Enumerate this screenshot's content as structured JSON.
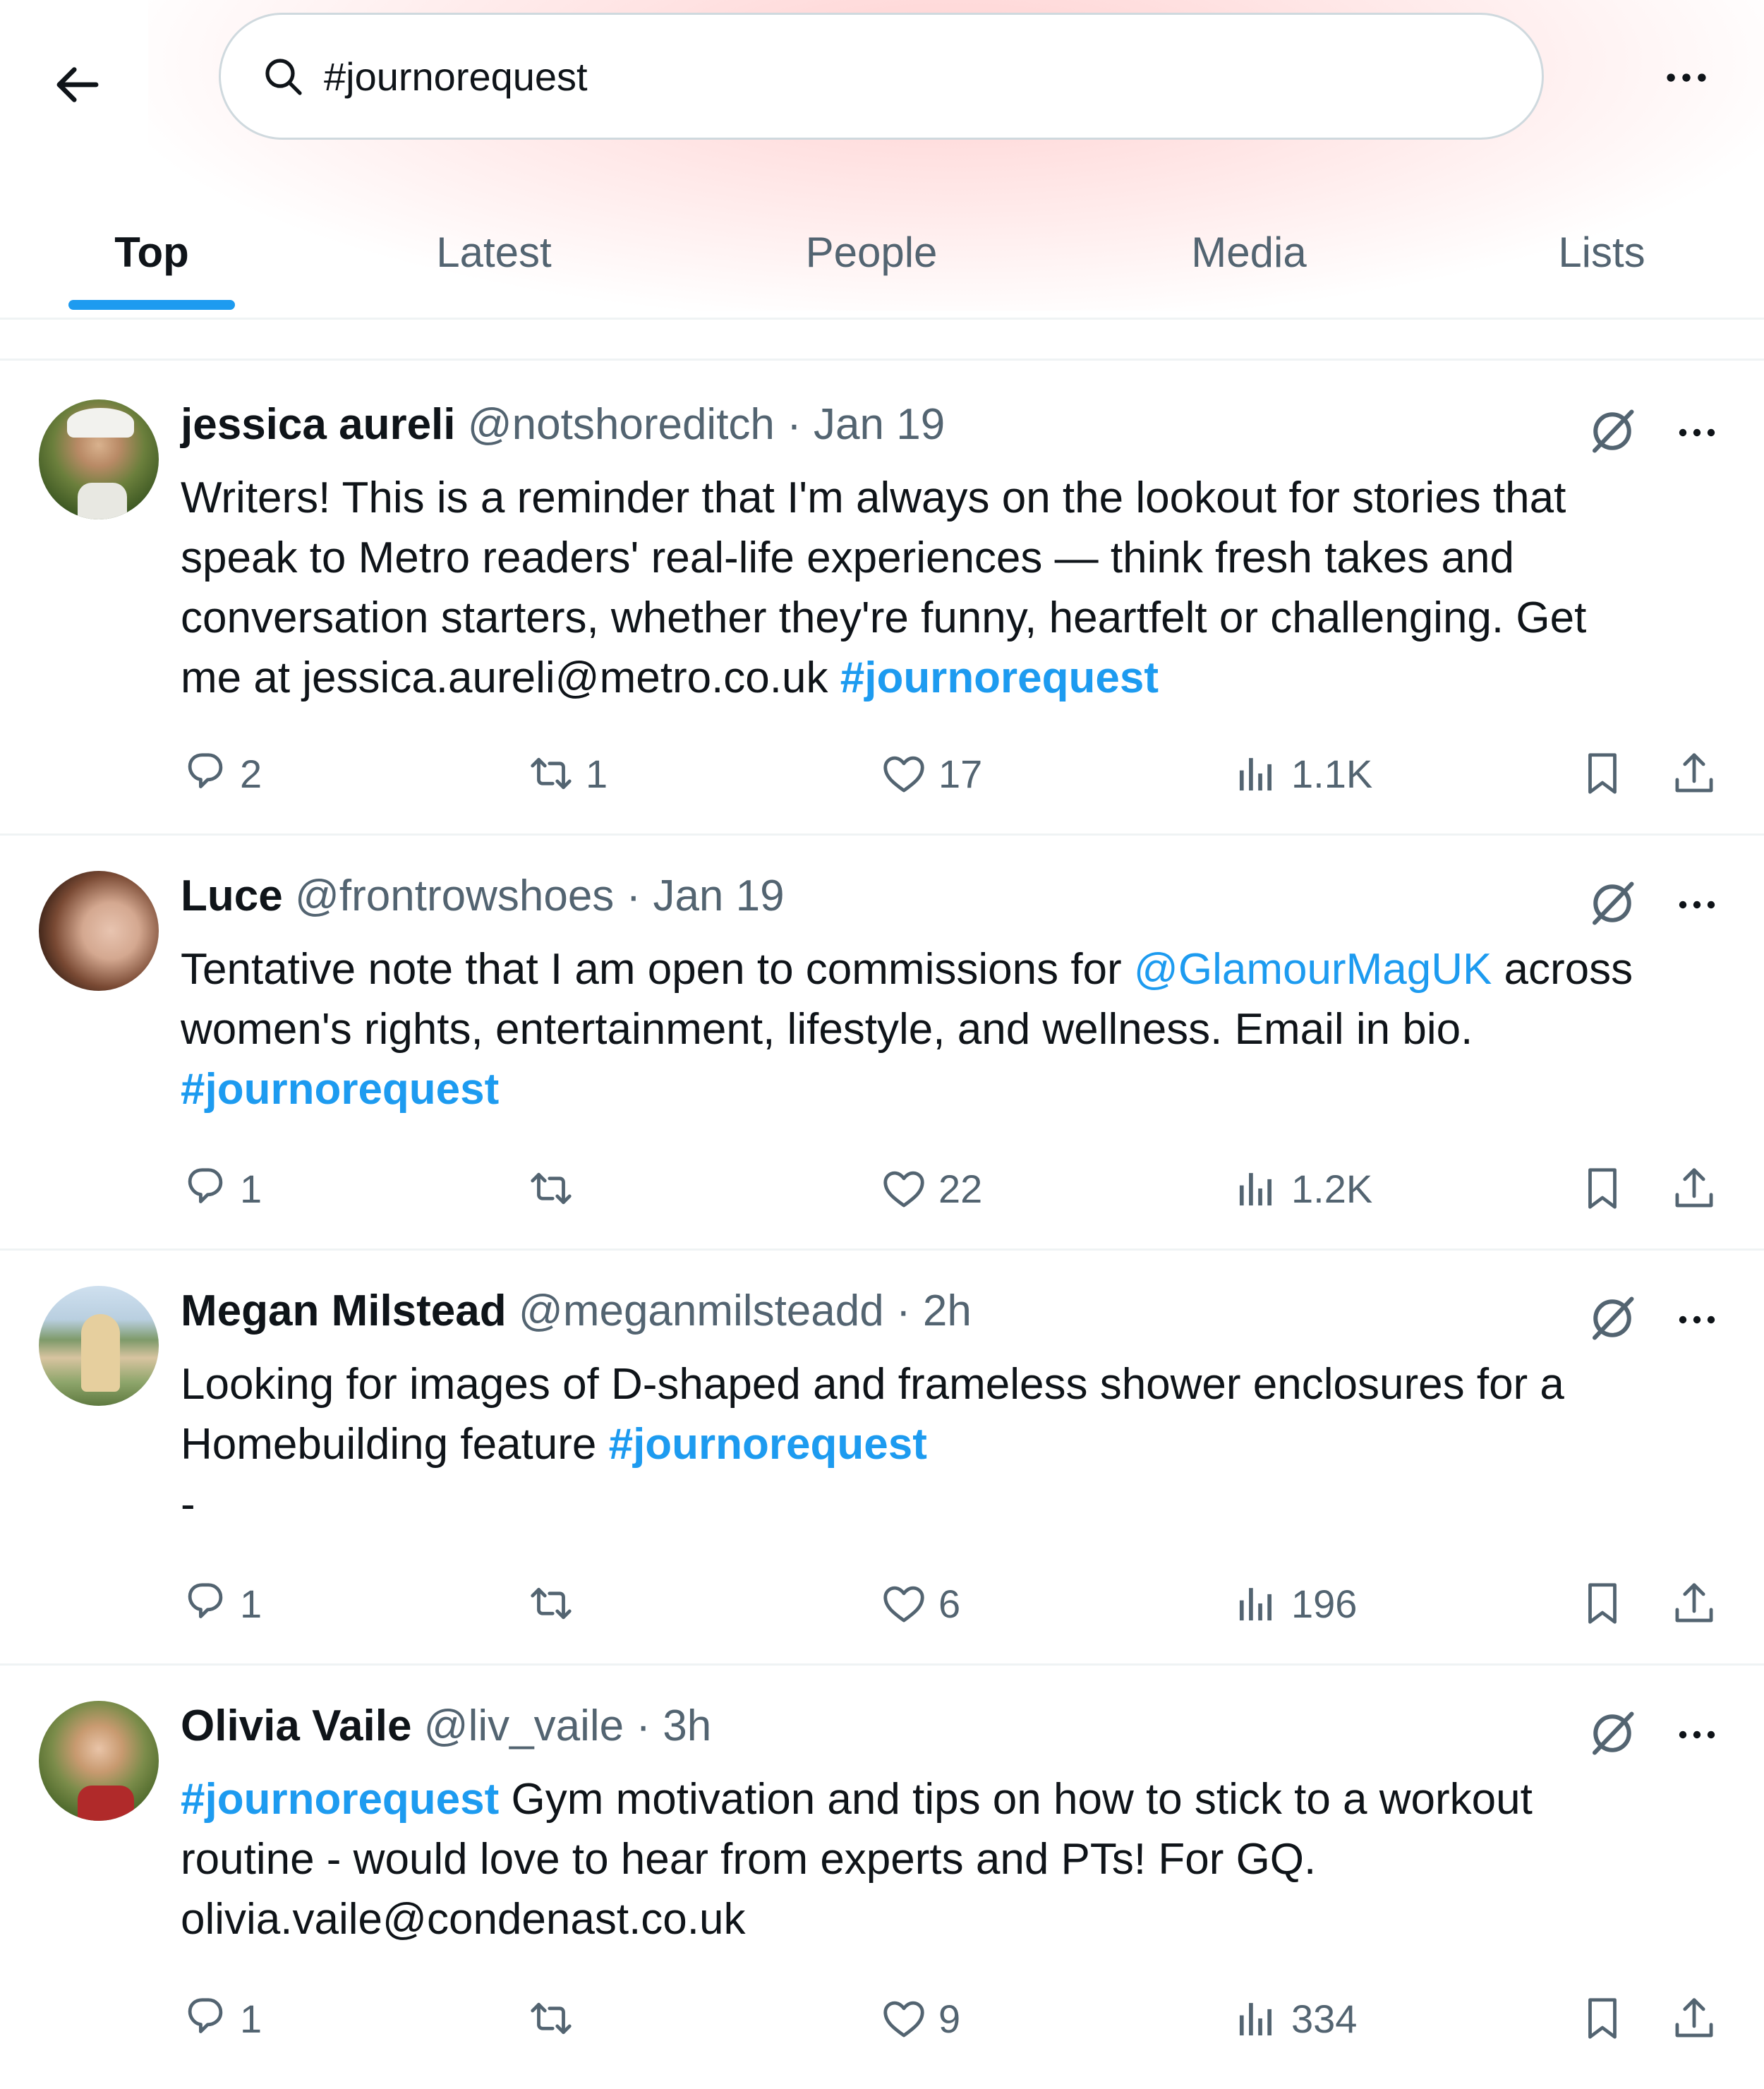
{
  "search": {
    "query": "#journorequest"
  },
  "tabs": [
    {
      "label": "Top"
    },
    {
      "label": "Latest"
    },
    {
      "label": "People"
    },
    {
      "label": "Media"
    },
    {
      "label": "Lists"
    }
  ],
  "tweets": [
    {
      "name": "jessica aureli",
      "handle": "@notshoreditch",
      "sep": "·",
      "time": "Jan 19",
      "text": {
        "l1": "Writers! This is a reminder that I'm always on the lookout for stories that",
        "l2": "speak to Metro readers' real-life experiences — think fresh takes and",
        "l3": "conversation starters, whether they're funny, heartfelt or challenging. Get",
        "l4a": "me at jessica.aureli@metro.co.uk ",
        "l4b": "#journorequest"
      },
      "replies": "2",
      "reposts": "1",
      "likes": "17",
      "views": "1.1K"
    },
    {
      "name": "Luce",
      "handle": "@frontrowshoes",
      "sep": "·",
      "time": "Jan 19",
      "text": {
        "l1a": "Tentative note that I am open to commissions for ",
        "l1b": "@GlamourMagUK",
        "l1c": " across",
        "l2": "women's rights, entertainment, lifestyle, and wellness. Email in bio.",
        "l3": "#journorequest"
      },
      "replies": "1",
      "reposts": "",
      "likes": "22",
      "views": "1.2K"
    },
    {
      "name": "Megan Milstead",
      "handle": "@meganmilsteadd",
      "sep": "·",
      "time": "2h",
      "text": {
        "l1": "Looking for images of D-shaped and frameless shower enclosures for a",
        "l2a": "Homebuilding feature ",
        "l2b": "#journorequest",
        "l3": "-"
      },
      "replies": "1",
      "reposts": "",
      "likes": "6",
      "views": "196"
    },
    {
      "name": "Olivia Vaile",
      "handle": "@liv_vaile",
      "sep": "·",
      "time": "3h",
      "text": {
        "l1a": "#journorequest",
        "l1b": " Gym motivation and tips on how to stick to a workout",
        "l2": "routine - would love to hear from experts and PTs! For GQ.",
        "l3": "olivia.vaile@condenast.co.uk"
      },
      "replies": "1",
      "reposts": "",
      "likes": "9",
      "views": "334"
    }
  ],
  "colors": {
    "accent": "#1d9bf0",
    "text": "#0f1419",
    "muted": "#536471",
    "divider": "#eff3f4"
  },
  "icons": [
    "back-arrow-icon",
    "search-icon",
    "more-icon",
    "grok-icon",
    "reply-icon",
    "repost-icon",
    "like-icon",
    "views-icon",
    "bookmark-icon",
    "share-icon"
  ]
}
